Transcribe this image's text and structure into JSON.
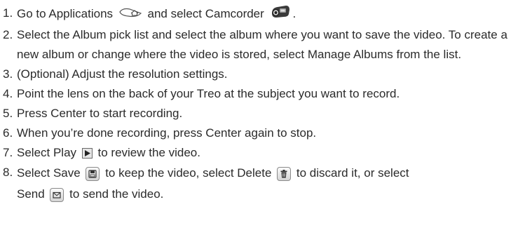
{
  "steps": [
    {
      "num": "1.",
      "a": "Go to Applications",
      "icon1": "applications-home-icon",
      "b": "and select Camcorder",
      "icon2": "camcorder-icon",
      "c": "."
    },
    {
      "num": "2.",
      "text": "Select the Album pick list and select the album where you want to save the video. To create a new album or change where the video is stored, select Manage Albums from the list."
    },
    {
      "num": "3.",
      "text": "(Optional) Adjust the resolution settings."
    },
    {
      "num": "4.",
      "text": "Point the lens on the back of your Treo at the subject you want to record."
    },
    {
      "num": "5.",
      "text": "Press Center to start recording."
    },
    {
      "num": "6.",
      "text": "When you’re done recording, press Center again to stop."
    },
    {
      "num": "7.",
      "a": "Select Play",
      "icon1": "play-icon",
      "b": "to review the video."
    },
    {
      "num": "8.",
      "a": "Select Save",
      "icon1": "save-icon",
      "b": "to keep the video, select Delete",
      "icon2": "delete-icon",
      "c": "to discard it, or select",
      "d": "Send",
      "icon3": "send-icon",
      "e": "to send the video."
    }
  ]
}
